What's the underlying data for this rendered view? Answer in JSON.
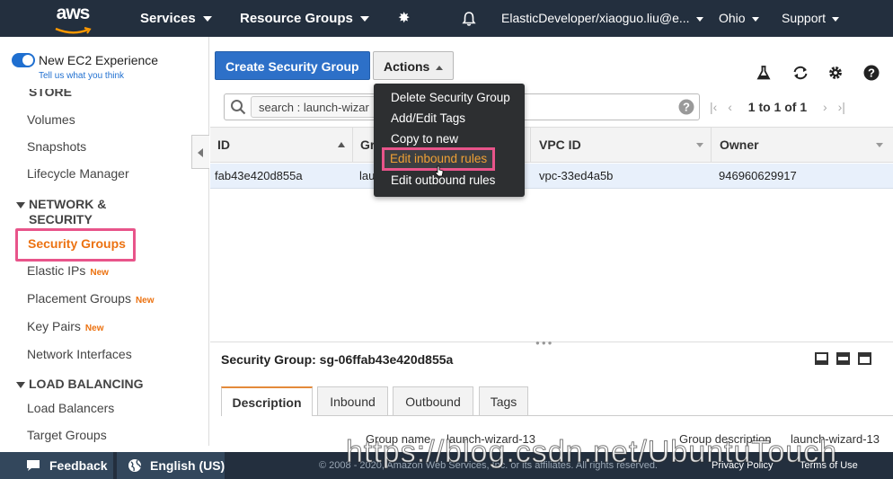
{
  "topnav": {
    "logo": "aws",
    "services": "Services",
    "resource_groups": "Resource Groups",
    "account": "ElasticDeveloper/xiaoguo.liu@e...",
    "region": "Ohio",
    "support": "Support"
  },
  "sidebar": {
    "experience_label": "New EC2 Experience",
    "experience_link": "Tell us what you think",
    "partial_heading": "STORE",
    "items_storage": [
      "Volumes",
      "Snapshots",
      "Lifecycle Manager"
    ],
    "section_network_line1": "NETWORK &",
    "section_network_line2": "SECURITY",
    "security_groups": "Security Groups",
    "elastic_ips": "Elastic IPs",
    "placement_groups": "Placement Groups",
    "key_pairs": "Key Pairs",
    "network_interfaces": "Network Interfaces",
    "new_badge": "New",
    "section_load_balancing": "LOAD BALANCING",
    "load_balancers": "Load Balancers",
    "target_groups": "Target Groups"
  },
  "toolbar": {
    "create_label": "Create Security Group",
    "actions_label": "Actions"
  },
  "search": {
    "token": "search : launch-wizar"
  },
  "pagination": {
    "text": "1 to 1 of 1"
  },
  "actions_menu": {
    "items": [
      "Delete Security Group",
      "Add/Edit Tags",
      "Copy to new",
      "Edit inbound rules",
      "Edit outbound rules"
    ],
    "highlighted": "Edit inbound rules"
  },
  "table": {
    "columns": [
      "ID",
      "Gr",
      "VPC ID",
      "Owner"
    ],
    "row": {
      "id": "fab43e420d855a",
      "group": "lau",
      "vpc": "vpc-33ed4a5b",
      "owner": "946960629917"
    }
  },
  "details": {
    "title": "Security Group: sg-06ffab43e420d855a",
    "tabs": [
      "Description",
      "Inbound",
      "Outbound",
      "Tags"
    ],
    "active_tab": "Description",
    "group_name_label": "Group name",
    "group_name_value": "launch-wizard-13",
    "group_desc_label": "Group description",
    "group_desc_value": "launch-wizard-13"
  },
  "footer": {
    "feedback": "Feedback",
    "language": "English (US)",
    "copyright": "© 2008 - 2020, Amazon Web Services, Inc. or its affiliates. All rights reserved.",
    "privacy": "Privacy Policy",
    "terms": "Terms of Use"
  },
  "watermark": "https://blog.csdn.net/UbuntuTouch",
  "colors": {
    "nav_bg": "#232f3e",
    "primary_button": "#2d70c8",
    "highlight_box": "#e8548a",
    "accent_orange": "#ec7211"
  }
}
